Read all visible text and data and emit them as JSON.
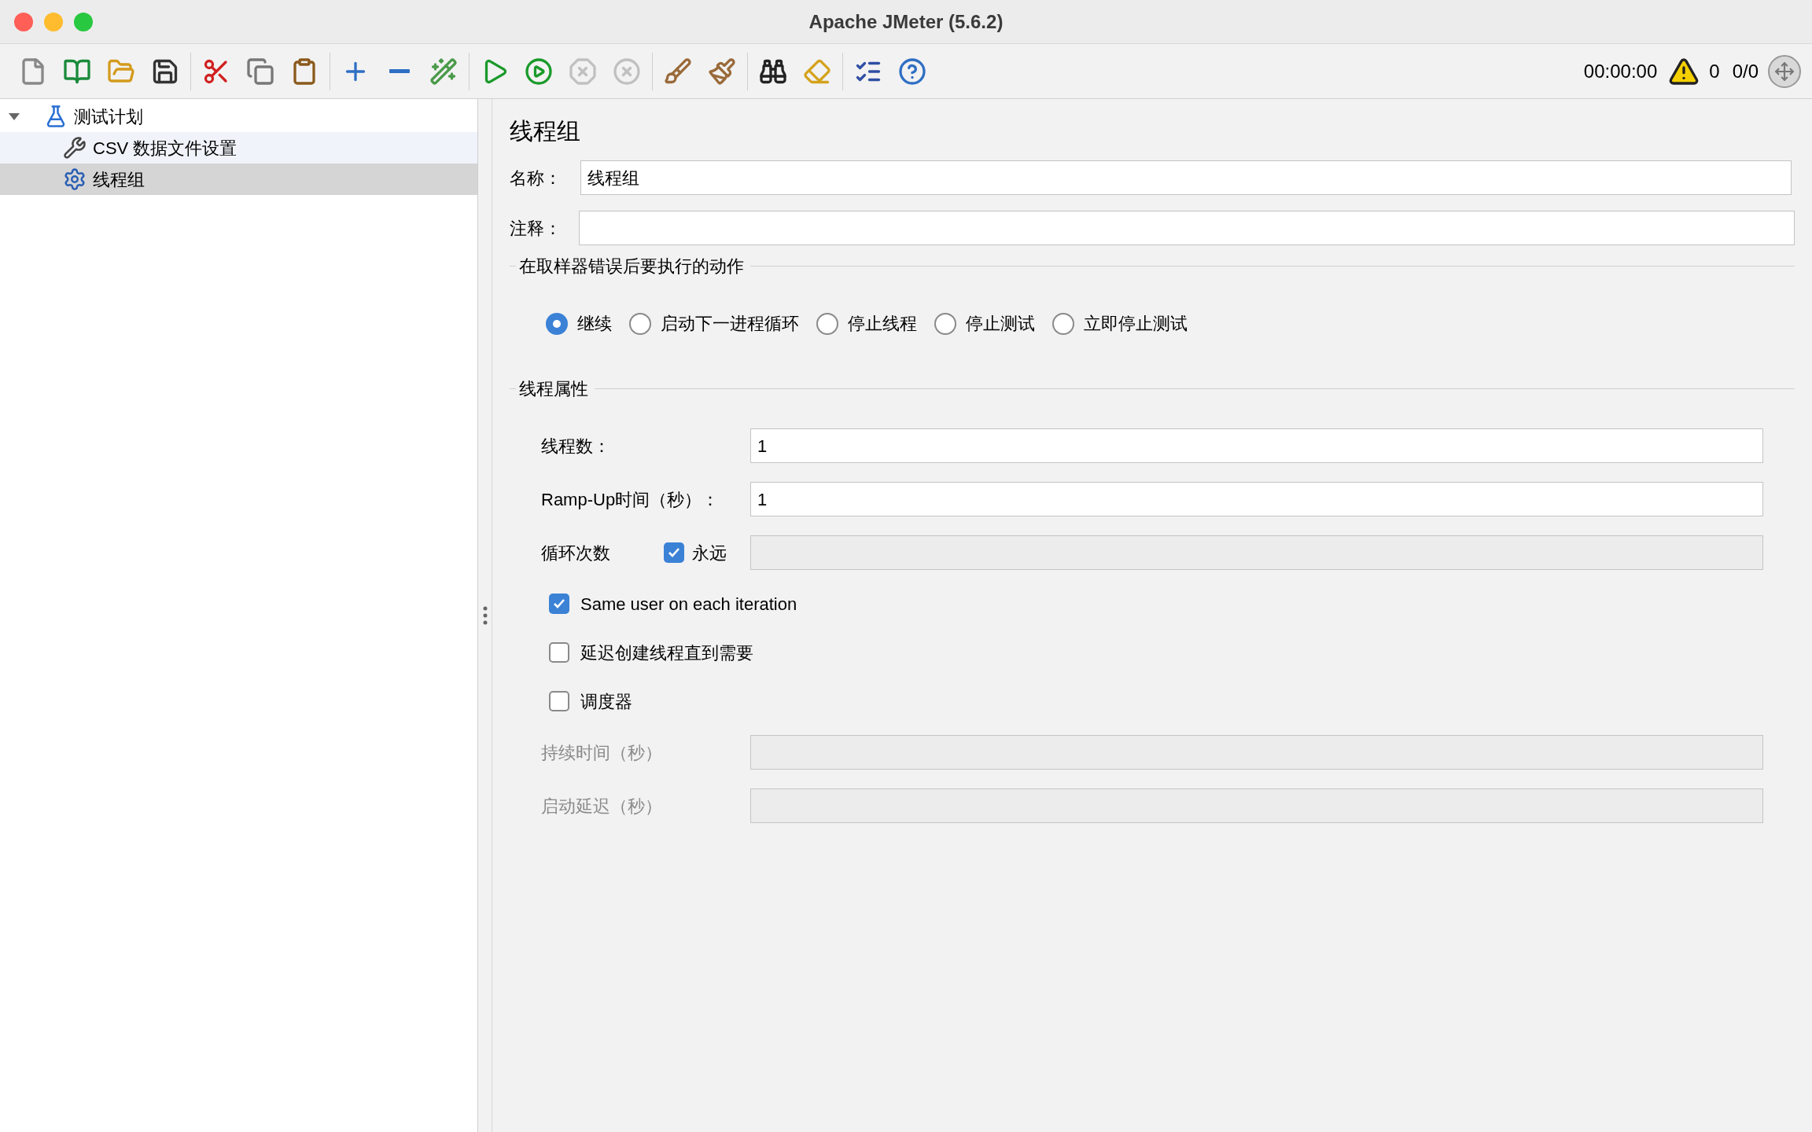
{
  "window": {
    "title": "Apache JMeter (5.6.2)"
  },
  "toolbar": [
    {
      "kind": "new",
      "disabled": false
    },
    {
      "kind": "templates",
      "disabled": false
    },
    {
      "kind": "open",
      "disabled": false
    },
    {
      "kind": "save",
      "disabled": false
    },
    {
      "kind": "cut",
      "disabled": false
    },
    {
      "kind": "copy",
      "disabled": false
    },
    {
      "kind": "paste",
      "disabled": false
    },
    {
      "kind": "expand",
      "disabled": false
    },
    {
      "kind": "collapse",
      "disabled": false
    },
    {
      "kind": "toggle",
      "disabled": false
    },
    {
      "kind": "start",
      "disabled": false
    },
    {
      "kind": "start-no-pause",
      "disabled": false
    },
    {
      "kind": "stop",
      "disabled": true
    },
    {
      "kind": "shutdown",
      "disabled": true
    },
    {
      "kind": "clear",
      "disabled": false
    },
    {
      "kind": "clear-all",
      "disabled": false
    },
    {
      "kind": "search",
      "disabled": false
    },
    {
      "kind": "reset-search",
      "disabled": false
    },
    {
      "kind": "functions",
      "disabled": false
    },
    {
      "kind": "help",
      "disabled": false
    }
  ],
  "status": {
    "timer": "00:00:00",
    "warnings": "0",
    "threads": "0/0"
  },
  "tree": [
    {
      "label": "测试计划",
      "kind": "plan",
      "expanded": true,
      "selected": false,
      "children": [
        {
          "label": "CSV 数据文件设置",
          "kind": "config",
          "selected": false
        },
        {
          "label": "线程组",
          "kind": "thread-group",
          "selected": true
        }
      ]
    }
  ],
  "form": {
    "title": "线程组",
    "name": {
      "label": "名称：",
      "value": "线程组"
    },
    "comment": {
      "label": "注释："
    },
    "error_action": {
      "title": "在取样器错误后要执行的动作",
      "options": [
        {
          "label": "继续",
          "selected": true
        },
        {
          "label": "启动下一进程循环",
          "selected": false
        },
        {
          "label": "停止线程",
          "selected": false
        },
        {
          "label": "停止测试",
          "selected": false
        },
        {
          "label": "立即停止测试",
          "selected": false
        }
      ]
    },
    "thread_props": {
      "title": "线程属性",
      "rows": [
        {
          "kind": "field",
          "label": "线程数：",
          "value": "1",
          "disabled": false
        },
        {
          "kind": "field",
          "label": "Ramp-Up时间（秒）：",
          "value": "1",
          "disabled": false
        },
        {
          "kind": "loop",
          "label": "循环次数",
          "checkbox": {
            "label": "永远",
            "checked": true
          },
          "disabled": true
        },
        {
          "kind": "checkbox",
          "label": "Same user on each iteration",
          "checked": true
        },
        {
          "kind": "checkbox",
          "label": "延迟创建线程直到需要",
          "checked": false
        },
        {
          "kind": "checkbox",
          "label": "调度器",
          "checked": false
        },
        {
          "kind": "field",
          "label": "持续时间（秒）",
          "disabled": true
        },
        {
          "kind": "field",
          "label": "启动延迟（秒）",
          "disabled": true
        }
      ]
    }
  }
}
